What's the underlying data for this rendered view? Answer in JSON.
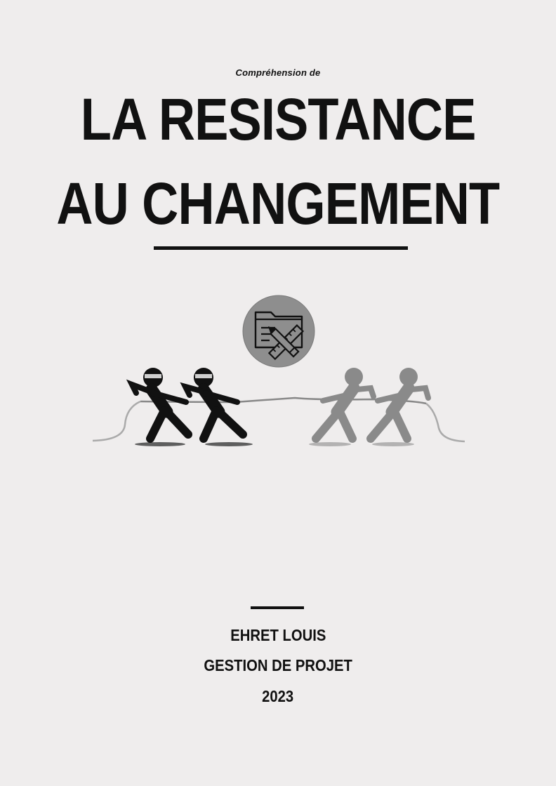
{
  "cover": {
    "subtitle": "Compréhension de",
    "title_line_1": "LA RESISTANCE",
    "title_line_2": "AU CHANGEMENT",
    "author": "EHRET LOUIS",
    "course": "GESTION DE PROJET",
    "year": "2023"
  },
  "illustration": {
    "icon": "folder-pencil-ruler-icon",
    "left_team_color": "#111111",
    "right_team_color": "#8a8a8a",
    "badge_color": "#8e8e8e"
  }
}
